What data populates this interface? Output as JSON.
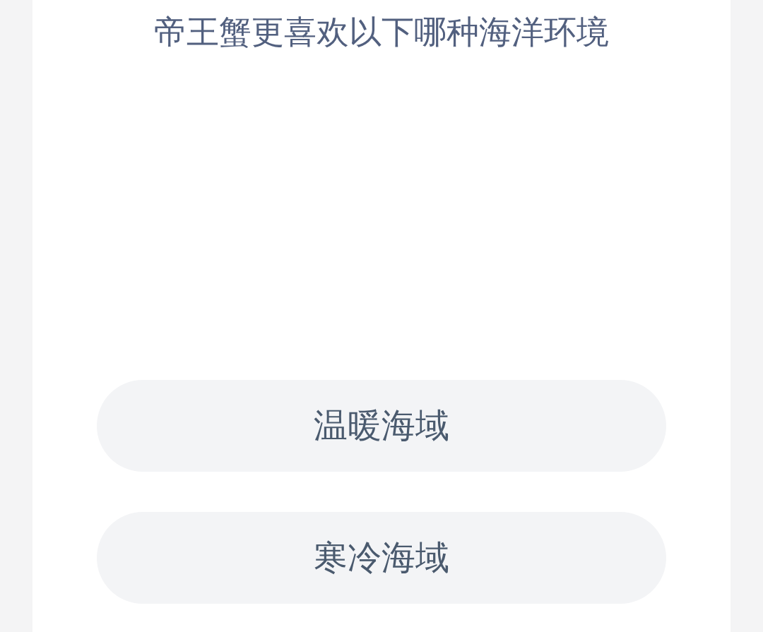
{
  "question": {
    "title": "帝王蟹更喜欢以下哪种海洋环境"
  },
  "options": [
    {
      "label": "温暖海域"
    },
    {
      "label": "寒冷海域"
    }
  ]
}
